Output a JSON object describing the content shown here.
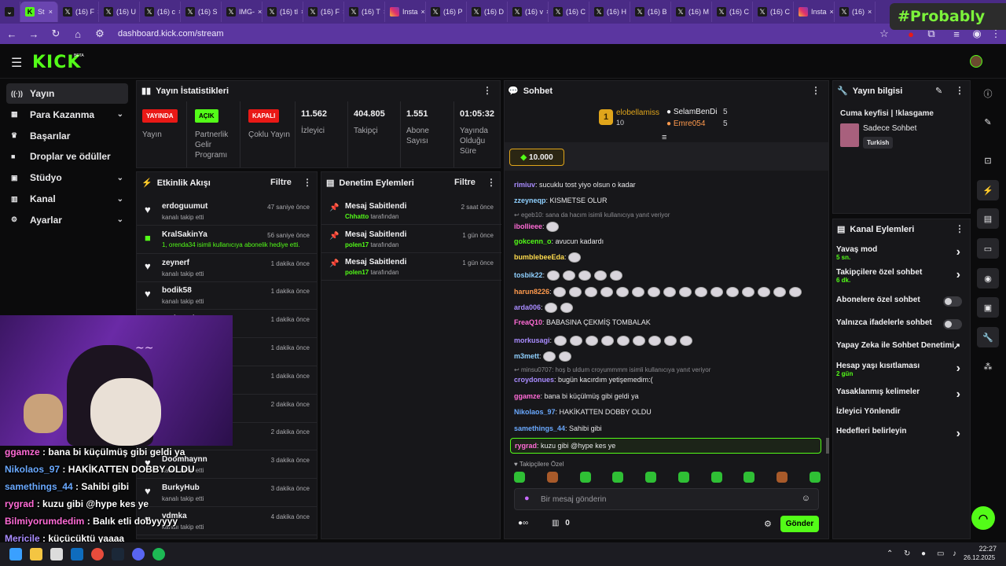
{
  "browser": {
    "tabs": [
      {
        "label": "St",
        "icon": "kick-favicon",
        "active": true
      },
      {
        "label": "(16) F",
        "icon": "x-favicon"
      },
      {
        "label": "(16) U",
        "icon": "x-favicon"
      },
      {
        "label": "(16) c",
        "icon": "x-favicon"
      },
      {
        "label": "(16) S",
        "icon": "x-favicon"
      },
      {
        "label": "IMG-",
        "icon": "x-favicon"
      },
      {
        "label": "(16) tl",
        "icon": "x-favicon"
      },
      {
        "label": "(16) F",
        "icon": "x-favicon"
      },
      {
        "label": "(16) T",
        "icon": "x-favicon"
      },
      {
        "label": "Insta",
        "icon": "instagram-favicon"
      },
      {
        "label": "(16) P",
        "icon": "x-favicon"
      },
      {
        "label": "(16) D",
        "icon": "x-favicon"
      },
      {
        "label": "(16) v",
        "icon": "x-favicon"
      },
      {
        "label": "(16) C",
        "icon": "x-favicon"
      },
      {
        "label": "(16) H",
        "icon": "x-favicon"
      },
      {
        "label": "(16) B",
        "icon": "x-favicon"
      },
      {
        "label": "(16) M",
        "icon": "x-favicon"
      },
      {
        "label": "(16) C",
        "icon": "x-favicon"
      },
      {
        "label": "(16) C",
        "icon": "x-favicon"
      },
      {
        "label": "Insta",
        "icon": "instagram-favicon"
      },
      {
        "label": "(16)",
        "icon": "x-favicon"
      }
    ],
    "url": "dashboard.kick.com/stream",
    "watermark": "#Probably"
  },
  "app": {
    "logo": "KICK",
    "beta": "BETA",
    "accent": "#53fc18"
  },
  "sidebar": {
    "items": [
      {
        "label": "Yayın",
        "icon": "broadcast-icon",
        "expandable": false,
        "selected": true
      },
      {
        "label": "Para Kazanma",
        "icon": "money-icon",
        "expandable": true
      },
      {
        "label": "Başarılar",
        "icon": "trophy-icon",
        "expandable": false
      },
      {
        "label": "Droplar ve ödüller",
        "icon": "gift-icon",
        "expandable": false
      },
      {
        "label": "Stüdyo",
        "icon": "studio-icon",
        "expandable": true
      },
      {
        "label": "Kanal",
        "icon": "channel-icon",
        "expandable": true
      },
      {
        "label": "Ayarlar",
        "icon": "settings-icon",
        "expandable": true
      }
    ]
  },
  "stats": {
    "title": "Yayın İstatistikleri",
    "badges": [
      {
        "badge": "YAYINDA",
        "label": "Yayın",
        "color": "#e91916"
      },
      {
        "badge": "AÇIK",
        "label": "Partnerlik Gelir Programı",
        "color": "#53fc18"
      },
      {
        "badge": "KAPALI",
        "label": "Çoklu Yayın",
        "color": "#e91916"
      }
    ],
    "values": [
      {
        "value": "11.562",
        "label": "İzleyici"
      },
      {
        "value": "404.805",
        "label": "Takipçi"
      },
      {
        "value": "1.551",
        "label": "Abone Sayısı"
      },
      {
        "value": "01:05:32",
        "label": "Yayında Olduğu Süre"
      }
    ]
  },
  "activity": {
    "title": "Etkinlik Akışı",
    "filter": "Filtre",
    "rows": [
      {
        "name": "erdoguumut",
        "sub": "kanalı takip etti",
        "time": "47 saniye önce",
        "icon": "heart-icon"
      },
      {
        "name": "KralSakinYa",
        "sub": "1, orenda34 isimli kullanıcıya abonelik hediye etti.",
        "time": "56 saniye önce",
        "icon": "gift-icon"
      },
      {
        "name": "zeynerf",
        "sub": "kanalı takip etti",
        "time": "1 dakika önce",
        "icon": "heart-icon"
      },
      {
        "name": "bodik58",
        "sub": "kanalı takip etti",
        "time": "1 dakika önce",
        "icon": "heart-icon"
      },
      {
        "name": "arabocuk",
        "sub": "",
        "time": "1 dakika önce",
        "icon": "heart-icon"
      },
      {
        "name": "",
        "sub": "",
        "time": "1 dakika önce",
        "icon": "heart-icon"
      },
      {
        "name": "",
        "sub": "",
        "time": "1 dakika önce",
        "icon": "heart-icon"
      },
      {
        "name": "",
        "sub": "",
        "time": "2 dakika önce",
        "icon": "heart-icon"
      },
      {
        "name": "",
        "sub": "kanalı takip etti",
        "time": "2 dakika önce",
        "icon": "heart-icon"
      },
      {
        "name": "Doomhaynn",
        "sub": "kanalı takip etti",
        "time": "3 dakika önce",
        "icon": "heart-icon"
      },
      {
        "name": "BurkyHub",
        "sub": "kanalı takip etti",
        "time": "3 dakika önce",
        "icon": "heart-icon"
      },
      {
        "name": "vdmka",
        "sub": "kanalı takip etti",
        "time": "4 dakika önce",
        "icon": "heart-icon"
      }
    ]
  },
  "moderation": {
    "title": "Denetim Eylemleri",
    "filter": "Filtre",
    "rows": [
      {
        "action": "Mesaj Sabitlendi",
        "user": "Chhatto",
        "suffix": "tarafından",
        "time": "2 saat önce"
      },
      {
        "action": "Mesaj Sabitlendi",
        "user": "polen17",
        "suffix": "tarafından",
        "time": "1 gün önce"
      },
      {
        "action": "Mesaj Sabitlendi",
        "user": "polen17",
        "suffix": "tarafından",
        "time": "1 gün önce"
      }
    ]
  },
  "chat": {
    "title": "Sohbet",
    "leaderboard": [
      {
        "rank": "1",
        "name": "elobellamiss",
        "value": "10"
      },
      {
        "name": "SelamBenDi",
        "value": "5"
      },
      {
        "name": "Emre054",
        "value": "5"
      }
    ],
    "kicks_value": "10.000",
    "messages": [
      {
        "user": "rimiuv",
        "color": "#a98cff",
        "text": "sucuklu tost yiyo olsun o kadar",
        "emotes": 0
      },
      {
        "user": "zzeyneqp",
        "color": "#8fd0ff",
        "text": "KISMETSE OLUR",
        "emotes": 0
      },
      {
        "reply": "egeb10: sana da hacım",
        "reply_tail": "isimli kullanıcıya yanıt veriyor"
      },
      {
        "user": "ibollieee",
        "color": "#ff6bd6",
        "text": "",
        "emotes": 1
      },
      {
        "user": "gokcenn_o",
        "color": "#53fc18",
        "text": "avucun kadardı",
        "emotes": 0
      },
      {
        "user": "bumblebeeEda",
        "color": "#ffdb4d",
        "text": "",
        "emotes": 1
      },
      {
        "user": "tosbik22",
        "color": "#8fd0ff",
        "text": "",
        "emotes": 5
      },
      {
        "user": "harun8226",
        "color": "#ff9a4d",
        "text": "",
        "emotes": 16
      },
      {
        "user": "arda006",
        "color": "#a98cff",
        "text": "",
        "emotes": 2
      },
      {
        "user": "FreaQ10",
        "color": "#ff6bd6",
        "text": "BABASINA ÇEKMİŞ TOMBALAK",
        "emotes": 0
      },
      {
        "user": "morkusagi",
        "color": "#a98cff",
        "text": "",
        "emotes": 9
      },
      {
        "user": "m3mett",
        "color": "#8fd0ff",
        "text": "",
        "emotes": 2
      },
      {
        "reply": "minsu0707: hoş b uldum croyummmm",
        "reply_tail": "isimli kullanıcıya yanıt veriyor"
      },
      {
        "user": "croydonues",
        "color": "#a98cff",
        "text": "bugün kacırdım yetişemedim:(",
        "emotes": 0
      },
      {
        "user": "ggamze",
        "color": "#ff6bd6",
        "text": "bana bi küçülmüş gibi geldi ya",
        "emotes": 0
      },
      {
        "user": "Nikolaos_97",
        "color": "#6aa9ff",
        "text": "HAKİKATTEN DOBBY OLDU",
        "emotes": 0
      },
      {
        "user": "samethings_44",
        "color": "#6aa9ff",
        "text": "Sahibi gibi",
        "emotes": 0
      }
    ],
    "highlight": {
      "user": "rygrad",
      "text": "kuzu gibi @hype kes ye"
    },
    "followers_only": "Takipçilere Özel",
    "placeholder": "Bir mesaj gönderin",
    "send": "Gönder",
    "count": "0"
  },
  "stream_info": {
    "title": "Yayın bilgisi",
    "stream_title": "Cuma keyfisi | !klasgame",
    "category": "Sadece Sohbet",
    "tag": "Turkish"
  },
  "channel_actions": {
    "title": "Kanal Eylemleri",
    "items": [
      {
        "label": "Yavaş mod",
        "sub": "5 sn.",
        "control": "chevron"
      },
      {
        "label": "Takipçilere özel sohbet",
        "sub": "6 dk.",
        "control": "chevron"
      },
      {
        "label": "Abonelere özel sohbet",
        "sub": "",
        "control": "toggle"
      },
      {
        "label": "Yalnızca ifadelerle sohbet",
        "sub": "",
        "control": "toggle"
      },
      {
        "label": "Yapay Zeka ile Sohbet Denetimi",
        "sub": "",
        "control": "external"
      },
      {
        "label": "Hesap yaşı kısıtlaması",
        "sub": "2 gün",
        "control": "chevron"
      },
      {
        "label": "Yasaklanmış kelimeler",
        "sub": "",
        "control": "chevron"
      },
      {
        "label": "İzleyici Yönlendir",
        "sub": "",
        "control": "none"
      },
      {
        "label": "Hedefleri belirleyin",
        "sub": "",
        "control": "chevron"
      }
    ]
  },
  "overlay_chat": [
    {
      "user": "ggamze",
      "text": "bana bi küçülmüş gibi geldi ya",
      "color": "#ff6bd6"
    },
    {
      "user": "Nikolaos_97",
      "text": "HAKİKATTEN DOBBY OLDU",
      "color": "#6aa9ff"
    },
    {
      "user": "samethings_44",
      "text": "Sahibi gibi",
      "color": "#6aa9ff"
    },
    {
      "user": "rygrad",
      "text": "kuzu gibi @hype kes ye",
      "color": "#ff6bd6"
    },
    {
      "user": "Bilmiyorumdedim",
      "text": "Balık etli dobyyyyy",
      "color": "#ff6bd6"
    },
    {
      "user": "Mericile",
      "text": "küçücüktü yaaaa",
      "color": "#a98cff"
    }
  ],
  "taskbar": {
    "time": "22:27",
    "date": "26.12.2025"
  }
}
